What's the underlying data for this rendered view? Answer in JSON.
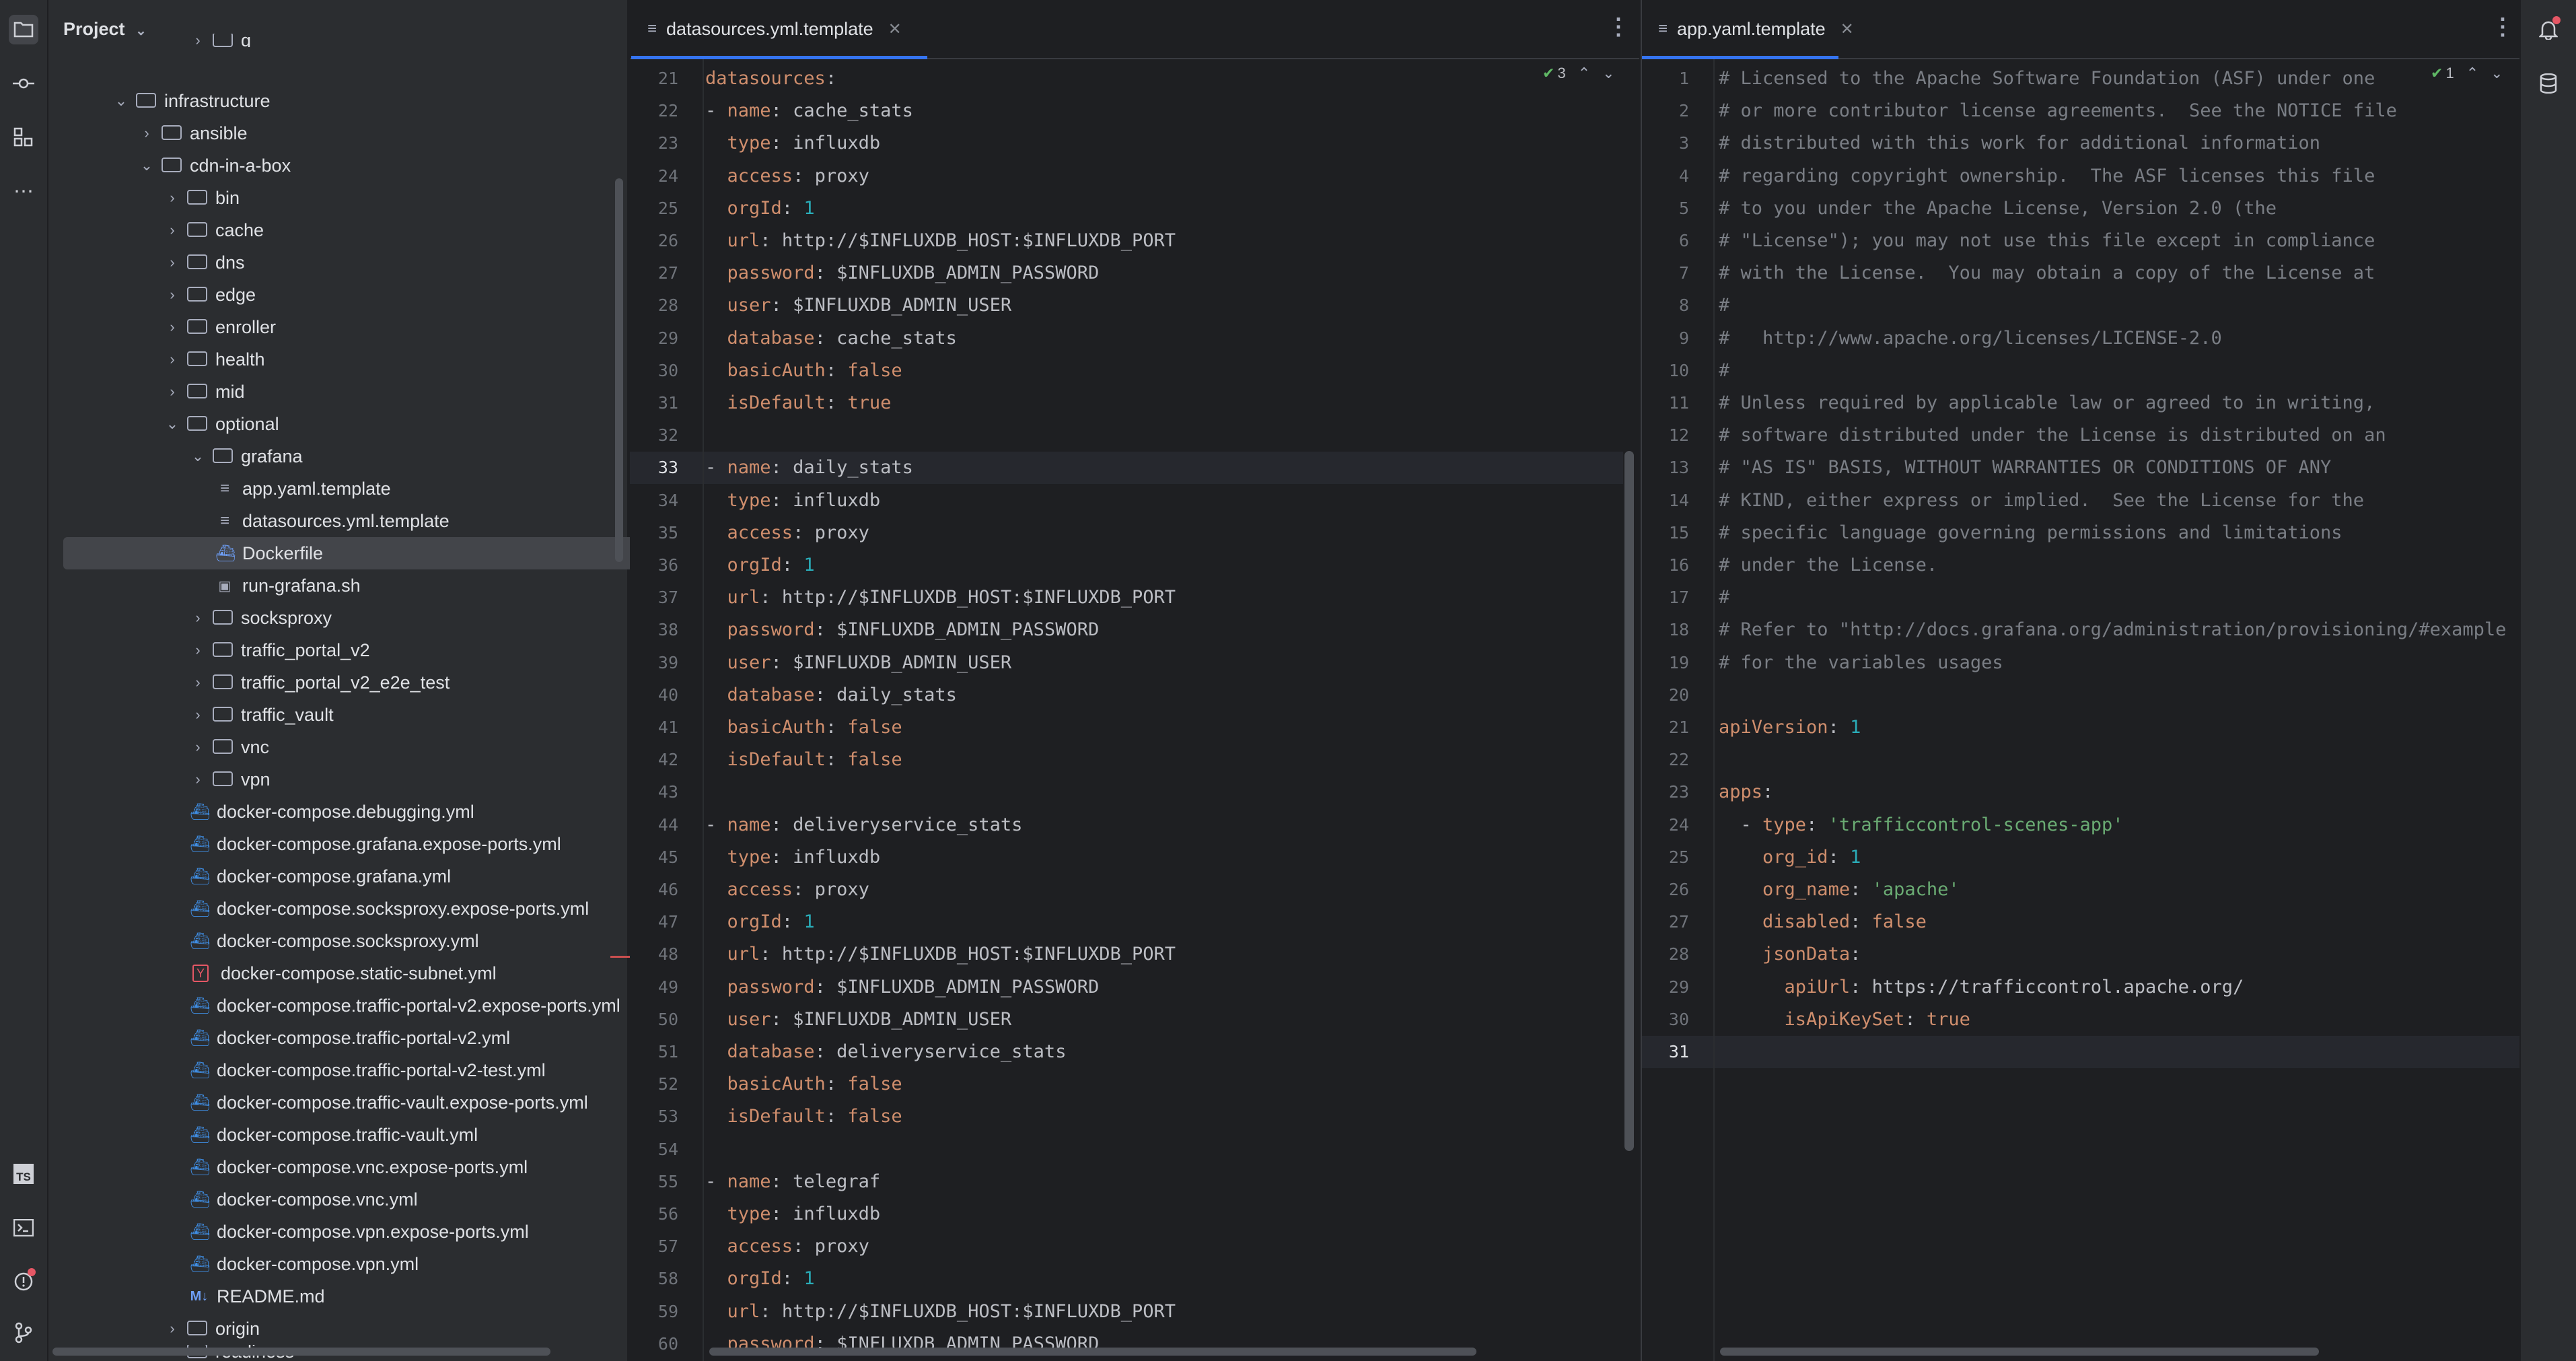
{
  "left_toolbar": {
    "icons": [
      "folder-icon",
      "commit-icon",
      "structure-icon",
      "more-icon",
      "typescript-icon",
      "terminal-icon",
      "problems-icon",
      "git-icon"
    ],
    "ts_label": "TS"
  },
  "right_toolbar": {
    "icons": [
      "notifications-icon",
      "database-icon"
    ]
  },
  "project": {
    "title": "Project",
    "tree": [
      {
        "label": "g",
        "depth": 4,
        "type": "folder",
        "open": false,
        "partial": true
      },
      {
        "label": "infrastructure",
        "depth": 1,
        "type": "folder",
        "open": true
      },
      {
        "label": "ansible",
        "depth": 2,
        "type": "folder",
        "open": false
      },
      {
        "label": "cdn-in-a-box",
        "depth": 2,
        "type": "folder",
        "open": true
      },
      {
        "label": "bin",
        "depth": 3,
        "type": "folder",
        "open": false
      },
      {
        "label": "cache",
        "depth": 3,
        "type": "folder",
        "open": false
      },
      {
        "label": "dns",
        "depth": 3,
        "type": "folder",
        "open": false
      },
      {
        "label": "edge",
        "depth": 3,
        "type": "folder",
        "open": false
      },
      {
        "label": "enroller",
        "depth": 3,
        "type": "folder",
        "open": false
      },
      {
        "label": "health",
        "depth": 3,
        "type": "folder",
        "open": false
      },
      {
        "label": "mid",
        "depth": 3,
        "type": "folder",
        "open": false
      },
      {
        "label": "optional",
        "depth": 3,
        "type": "folder",
        "open": true
      },
      {
        "label": "grafana",
        "depth": 4,
        "type": "folder",
        "open": true
      },
      {
        "label": "app.yaml.template",
        "depth": 5,
        "type": "text"
      },
      {
        "label": "datasources.yml.template",
        "depth": 5,
        "type": "text"
      },
      {
        "label": "Dockerfile",
        "depth": 5,
        "type": "dockerfile",
        "selected": true
      },
      {
        "label": "run-grafana.sh",
        "depth": 5,
        "type": "sh"
      },
      {
        "label": "socksproxy",
        "depth": 4,
        "type": "folder",
        "open": false
      },
      {
        "label": "traffic_portal_v2",
        "depth": 4,
        "type": "folder",
        "open": false
      },
      {
        "label": "traffic_portal_v2_e2e_test",
        "depth": 4,
        "type": "folder",
        "open": false
      },
      {
        "label": "traffic_vault",
        "depth": 4,
        "type": "folder",
        "open": false
      },
      {
        "label": "vnc",
        "depth": 4,
        "type": "folder",
        "open": false
      },
      {
        "label": "vpn",
        "depth": 4,
        "type": "folder",
        "open": false
      },
      {
        "label": "docker-compose.debugging.yml",
        "depth": 4,
        "type": "docker"
      },
      {
        "label": "docker-compose.grafana.expose-ports.yml",
        "depth": 4,
        "type": "docker"
      },
      {
        "label": "docker-compose.grafana.yml",
        "depth": 4,
        "type": "docker"
      },
      {
        "label": "docker-compose.socksproxy.expose-ports.yml",
        "depth": 4,
        "type": "docker"
      },
      {
        "label": "docker-compose.socksproxy.yml",
        "depth": 4,
        "type": "docker"
      },
      {
        "label": "docker-compose.static-subnet.yml",
        "depth": 4,
        "type": "yaml"
      },
      {
        "label": "docker-compose.traffic-portal-v2.expose-ports.yml",
        "depth": 4,
        "type": "docker"
      },
      {
        "label": "docker-compose.traffic-portal-v2.yml",
        "depth": 4,
        "type": "docker"
      },
      {
        "label": "docker-compose.traffic-portal-v2-test.yml",
        "depth": 4,
        "type": "docker"
      },
      {
        "label": "docker-compose.traffic-vault.expose-ports.yml",
        "depth": 4,
        "type": "docker"
      },
      {
        "label": "docker-compose.traffic-vault.yml",
        "depth": 4,
        "type": "docker"
      },
      {
        "label": "docker-compose.vnc.expose-ports.yml",
        "depth": 4,
        "type": "docker"
      },
      {
        "label": "docker-compose.vnc.yml",
        "depth": 4,
        "type": "docker"
      },
      {
        "label": "docker-compose.vpn.expose-ports.yml",
        "depth": 4,
        "type": "docker"
      },
      {
        "label": "docker-compose.vpn.yml",
        "depth": 4,
        "type": "docker"
      },
      {
        "label": "README.md",
        "depth": 4,
        "type": "md"
      },
      {
        "label": "origin",
        "depth": 3,
        "type": "folder",
        "open": false
      },
      {
        "label": "readiness",
        "depth": 3,
        "type": "folder",
        "open": false,
        "partial": true
      }
    ]
  },
  "editor_left": {
    "tab_label": "datasources.yml.template",
    "inspection_count": "3",
    "current_line": 33,
    "first_line": 21,
    "lines": [
      "datasources:",
      "- name: cache_stats",
      "  type: influxdb",
      "  access: proxy",
      "  orgId: 1",
      "  url: http://$INFLUXDB_HOST:$INFLUXDB_PORT",
      "  password: $INFLUXDB_ADMIN_PASSWORD",
      "  user: $INFLUXDB_ADMIN_USER",
      "  database: cache_stats",
      "  basicAuth: false",
      "  isDefault: true",
      "",
      "- name: daily_stats",
      "  type: influxdb",
      "  access: proxy",
      "  orgId: 1",
      "  url: http://$INFLUXDB_HOST:$INFLUXDB_PORT",
      "  password: $INFLUXDB_ADMIN_PASSWORD",
      "  user: $INFLUXDB_ADMIN_USER",
      "  database: daily_stats",
      "  basicAuth: false",
      "  isDefault: false",
      "",
      "- name: deliveryservice_stats",
      "  type: influxdb",
      "  access: proxy",
      "  orgId: 1",
      "  url: http://$INFLUXDB_HOST:$INFLUXDB_PORT",
      "  password: $INFLUXDB_ADMIN_PASSWORD",
      "  user: $INFLUXDB_ADMIN_USER",
      "  database: deliveryservice_stats",
      "  basicAuth: false",
      "  isDefault: false",
      "",
      "- name: telegraf",
      "  type: influxdb",
      "  access: proxy",
      "  orgId: 1",
      "  url: http://$INFLUXDB_HOST:$INFLUXDB_PORT",
      "  password: $INFLUXDB_ADMIN_PASSWORD"
    ]
  },
  "editor_right": {
    "tab_label": "app.yaml.template",
    "inspection_count": "1",
    "current_line": 31,
    "first_line": 1,
    "lines": [
      "# Licensed to the Apache Software Foundation (ASF) under one",
      "# or more contributor license agreements.  See the NOTICE file",
      "# distributed with this work for additional information",
      "# regarding copyright ownership.  The ASF licenses this file",
      "# to you under the Apache License, Version 2.0 (the",
      "# \"License\"); you may not use this file except in compliance",
      "# with the License.  You may obtain a copy of the License at",
      "#",
      "#   http://www.apache.org/licenses/LICENSE-2.0",
      "#",
      "# Unless required by applicable law or agreed to in writing,",
      "# software distributed under the License is distributed on an",
      "# \"AS IS\" BASIS, WITHOUT WARRANTIES OR CONDITIONS OF ANY",
      "# KIND, either express or implied.  See the License for the",
      "# specific language governing permissions and limitations",
      "# under the License.",
      "#",
      "# Refer to \"http://docs.grafana.org/administration/provisioning/#example-da",
      "# for the variables usages",
      "",
      "apiVersion: 1",
      "",
      "apps:",
      "  - type: 'trafficcontrol-scenes-app'",
      "    org_id: 1",
      "    org_name: 'apache'",
      "    disabled: false",
      "    jsonData:",
      "      apiUrl: https://trafficcontrol.apache.org/",
      "      isApiKeySet: true",
      ""
    ]
  },
  "colors": {
    "bg": "#1e1f22",
    "panel": "#2b2d30",
    "accent": "#3574f0",
    "comment": "#7a7e85",
    "key": "#cf8e6d",
    "string": "#6aab73",
    "number": "#2aacb8",
    "text": "#bcbec4"
  }
}
